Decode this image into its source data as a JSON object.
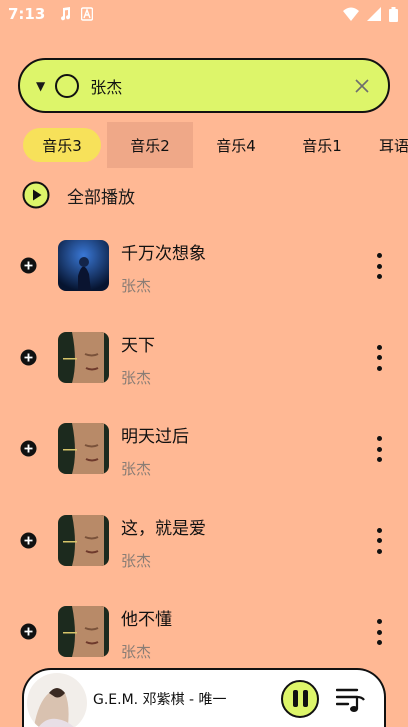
{
  "status_bar": {
    "time": "7:13",
    "icons_left": [
      "music-note-icon",
      "font-a-icon"
    ],
    "icons_right": [
      "wifi-icon",
      "signal-icon",
      "battery-icon"
    ]
  },
  "search": {
    "value": "张杰",
    "placeholder": ""
  },
  "tabs": [
    {
      "label": "音乐3"
    },
    {
      "label": "音乐2"
    },
    {
      "label": "音乐4"
    },
    {
      "label": "音乐1"
    },
    {
      "label": "耳语"
    }
  ],
  "play_all": {
    "label": "全部播放"
  },
  "songs": [
    {
      "title": "千万次想象",
      "artist": "张杰"
    },
    {
      "title": "天下",
      "artist": "张杰"
    },
    {
      "title": "明天过后",
      "artist": "张杰"
    },
    {
      "title": "这，就是爱",
      "artist": "张杰"
    },
    {
      "title": "他不懂",
      "artist": "张杰"
    }
  ],
  "player": {
    "track": "G.E.M. 邓紫棋 - 唯一",
    "playing": true
  },
  "colors": {
    "background": "#FFB894",
    "accent_green": "#DDF56A",
    "accent_yellow": "#F7E15A",
    "tab_highlight": "#EFA888"
  }
}
